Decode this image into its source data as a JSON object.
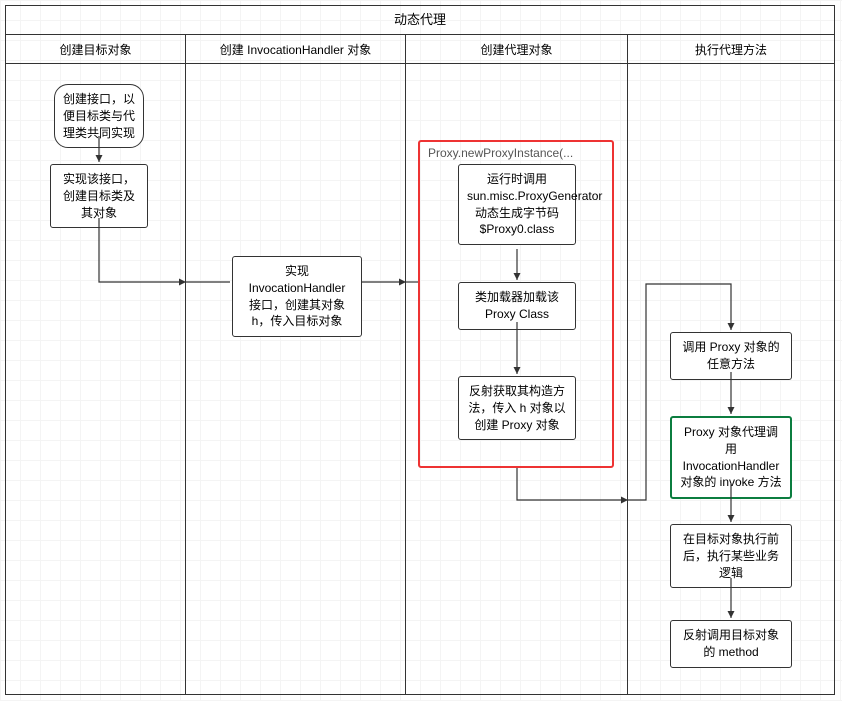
{
  "diagram": {
    "title": "动态代理",
    "lanes": {
      "l1": "创建目标对象",
      "l2": "创建 InvocationHandler 对象",
      "l3": "创建代理对象",
      "l4": "执行代理方法"
    },
    "nodes": {
      "start": "创建接口，以便目标类与代理类共同实现",
      "impl": "实现该接口，创建目标类及其对象",
      "cih": "实现 InvocationHandler 接口，创建其对象 h，传入目标对象",
      "groupLabel": "Proxy.newProxyInstance(...",
      "g1": "运行时调用 sun.misc.ProxyGenerator 动态生成字节码 $Proxy0.class",
      "g2": "类加载器加载该 Proxy Class",
      "g3": "反射获取其构造方法，传入 h 对象以创建 Proxy 对象",
      "e1": "调用 Proxy 对象的任意方法",
      "e2": "Proxy 对象代理调用 InvocationHandler 对象的 invoke 方法",
      "e3": "在目标对象执行前后，执行某些业务逻辑",
      "e4": "反射调用目标对象的 method"
    }
  }
}
